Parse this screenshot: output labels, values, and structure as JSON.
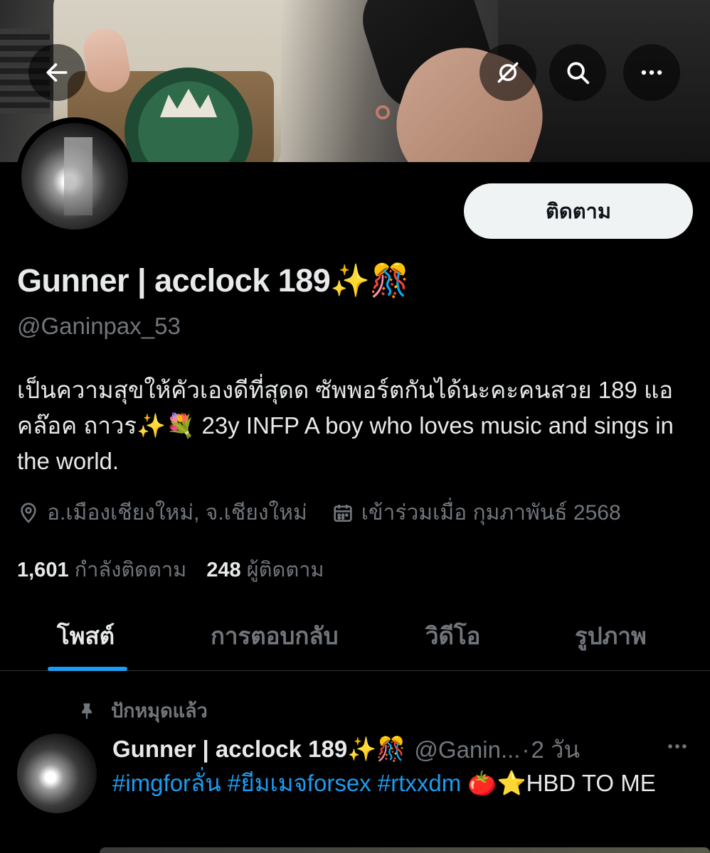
{
  "banner": {
    "back_icon": "arrow-left-icon",
    "grok_icon": "grok-icon",
    "search_icon": "search-icon",
    "more_icon": "more-horizontal-icon"
  },
  "profile": {
    "follow_label": "ติดตาม",
    "display_name": "Gunner | acclock 189✨🎊",
    "handle": "@Ganinpax_53",
    "bio": "เป็นความสุขให้คัวเองดีที่สุดด ซัพพอร์ตกันได้นะคะคนสวย 189 แอคล๊อค ถาวร✨💐 23y INFP A boy who loves music and sings in the world.",
    "location": "อ.เมืองเชียงใหม่, จ.เชียงใหม่",
    "joined": "เข้าร่วมเมื่อ กุมภาพันธ์ 2568",
    "following_count": "1,601",
    "following_label": "กำลังติดตาม",
    "followers_count": "248",
    "followers_label": "ผู้ติดตาม"
  },
  "tabs": [
    {
      "label": "โพสต์",
      "active": true
    },
    {
      "label": "การตอบกลับ",
      "active": false
    },
    {
      "label": "วิดีโอ",
      "active": false
    },
    {
      "label": "รูปภาพ",
      "active": false
    }
  ],
  "post": {
    "pinned_label": "ปักหมุดแล้ว",
    "author_name": "Gunner | acclock 189✨🎊",
    "author_handle": "@Ganin...",
    "separator": "·",
    "time": "2 วัน",
    "hashtags": [
      "#imgforลั่น",
      "#ยีมเมจforsex",
      "#rtxxdm"
    ],
    "text_tail": "🍅⭐HBD TO ME"
  },
  "colors": {
    "accent": "#1d9bf0",
    "secondary_text": "#71767b",
    "primary_text": "#e7e9ea",
    "background": "#000000"
  }
}
